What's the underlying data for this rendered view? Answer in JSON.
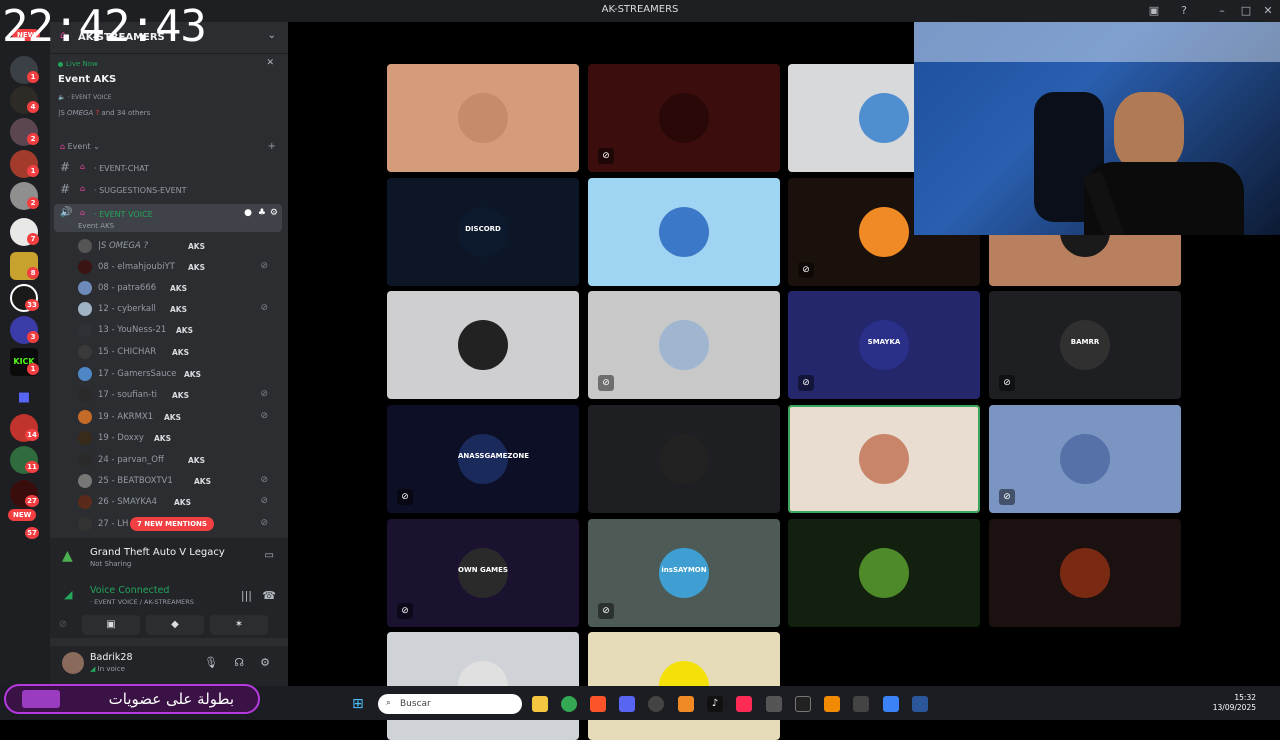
{
  "titlebar": {
    "title": "AK-STREAMERS"
  },
  "overlay_clock": "22:42:43",
  "guilds": {
    "new_top": "NEW",
    "new_bottom": "NEW",
    "badges": [
      "1",
      "4",
      "2",
      "1",
      "2",
      "7",
      "8",
      "33",
      "3",
      "1",
      "14",
      "11",
      "27",
      "57"
    ]
  },
  "server": {
    "name": "AK-STREAMERS",
    "live": {
      "status": "Live Now",
      "event_title": "Event AKS",
      "channel": "· EVENT VOICE",
      "participants": "|S",
      "participant_name": "OMEGA",
      "others": "and 34 others"
    },
    "category": "Event",
    "channels": [
      {
        "name": "· EVENT-CHAT"
      },
      {
        "name": "· SUGGESTIONS-EVENT"
      }
    ],
    "voice_channel": {
      "name": "· EVENT VOICE",
      "subtitle": "Event AKS"
    },
    "voice_users": [
      {
        "name": "|S OMEGA ?",
        "tag": "AKS"
      },
      {
        "name": "08 - elmahjoubiYT",
        "tag": "AKS"
      },
      {
        "name": "08 - patra666",
        "tag": "AKS"
      },
      {
        "name": "12 - cyberkall",
        "tag": "AKS"
      },
      {
        "name": "13 - YouNess-21",
        "tag": "AKS"
      },
      {
        "name": "15 - CHICHAR",
        "tag": "AKS"
      },
      {
        "name": "17 - GamersSauce",
        "tag": "AKS"
      },
      {
        "name": "17 - soufian-ti",
        "tag": "AKS"
      },
      {
        "name": "19 - AKRMX1",
        "tag": "AKS"
      },
      {
        "name": "19 - Doxxy",
        "tag": "AKS"
      },
      {
        "name": "24 - parvan_Off",
        "tag": "AKS"
      },
      {
        "name": "25 - BEATBOXTV1",
        "tag": "AKS"
      },
      {
        "name": "26 - SMAYKA4",
        "tag": "AKS"
      },
      {
        "name": "27 - LH",
        "tag": ""
      }
    ],
    "mentions": "7 NEW MENTIONS"
  },
  "activity": {
    "game": "Grand Theft Auto V Legacy",
    "status": "Not Sharing"
  },
  "voice": {
    "status": "Voice Connected",
    "location": "· EVENT VOICE / AK-STREAMERS"
  },
  "user": {
    "name": "Badrik28",
    "status": "In voice"
  },
  "tiles": [
    {
      "bg": "#d59c7b",
      "label": "",
      "muted": false
    },
    {
      "bg": "#3b0d0d",
      "label": "",
      "muted": true
    },
    {
      "bg": "#d7d9db",
      "label": "",
      "muted": false
    },
    {
      "bg": "#3f4944",
      "label": "",
      "muted": false
    },
    {
      "bg": "#0c1626",
      "label": "DISCORD",
      "muted": false
    },
    {
      "bg": "#9fd4f2",
      "label": "",
      "muted": false
    },
    {
      "bg": "#1a100c",
      "label": "",
      "muted": true
    },
    {
      "bg": "#b8805e",
      "label": "",
      "muted": false
    },
    {
      "bg": "#cfcfd1",
      "label": "",
      "muted": false
    },
    {
      "bg": "#c8c8c8",
      "label": "",
      "muted": true
    },
    {
      "bg": "#24276b",
      "label": "SMAYKA",
      "muted": true
    },
    {
      "bg": "#1e1f22",
      "label": "BAMRR",
      "muted": true
    },
    {
      "bg": "#0d0f26",
      "label": "ANASSGAMEZONE",
      "muted": true
    },
    {
      "bg": "#1e1f22",
      "label": "",
      "muted": false
    },
    {
      "bg": "#e9ddd2",
      "label": "",
      "muted": false
    },
    {
      "bg": "#7b95c2",
      "label": "",
      "muted": true
    },
    {
      "bg": "#1b1230",
      "label": "OWN GAMES",
      "muted": true
    },
    {
      "bg": "#4e5a55",
      "label": "insSAYMON",
      "muted": true
    },
    {
      "bg": "#13200f",
      "label": "",
      "muted": false
    },
    {
      "bg": "#1b1111",
      "label": "",
      "muted": false
    },
    {
      "bg": "#cfd2d6",
      "label": "",
      "muted": false
    },
    {
      "bg": "#e6dcb9",
      "label": "",
      "muted": false
    }
  ],
  "taskbar": {
    "search_placeholder": "Buscar",
    "time": "15:32",
    "date": "13/09/2025"
  },
  "banner": {
    "text": "بطولة على عضويات"
  },
  "colors": {
    "accent_green": "#23a55a",
    "danger_red": "#f23f42",
    "sidebar": "#2b2d31"
  }
}
